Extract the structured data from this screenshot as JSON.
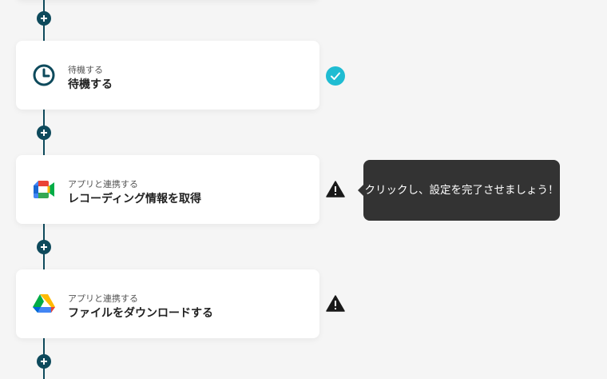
{
  "flow": {
    "steps": [
      {
        "subtitle": "待機する",
        "title": "待機する",
        "icon": "clock-icon",
        "status": "complete"
      },
      {
        "subtitle": "アプリと連携する",
        "title": "レコーディング情報を取得",
        "icon": "google-meet-icon",
        "status": "warning"
      },
      {
        "subtitle": "アプリと連携する",
        "title": "ファイルをダウンロードする",
        "icon": "google-drive-icon",
        "status": "warning"
      }
    ]
  },
  "tooltip": {
    "text": "クリックし、設定を完了させましょう！"
  },
  "colors": {
    "connector": "#0e4a5c",
    "check": "#1fbcd2",
    "warning": "#1a1a1a",
    "tooltip_bg": "#333333"
  }
}
